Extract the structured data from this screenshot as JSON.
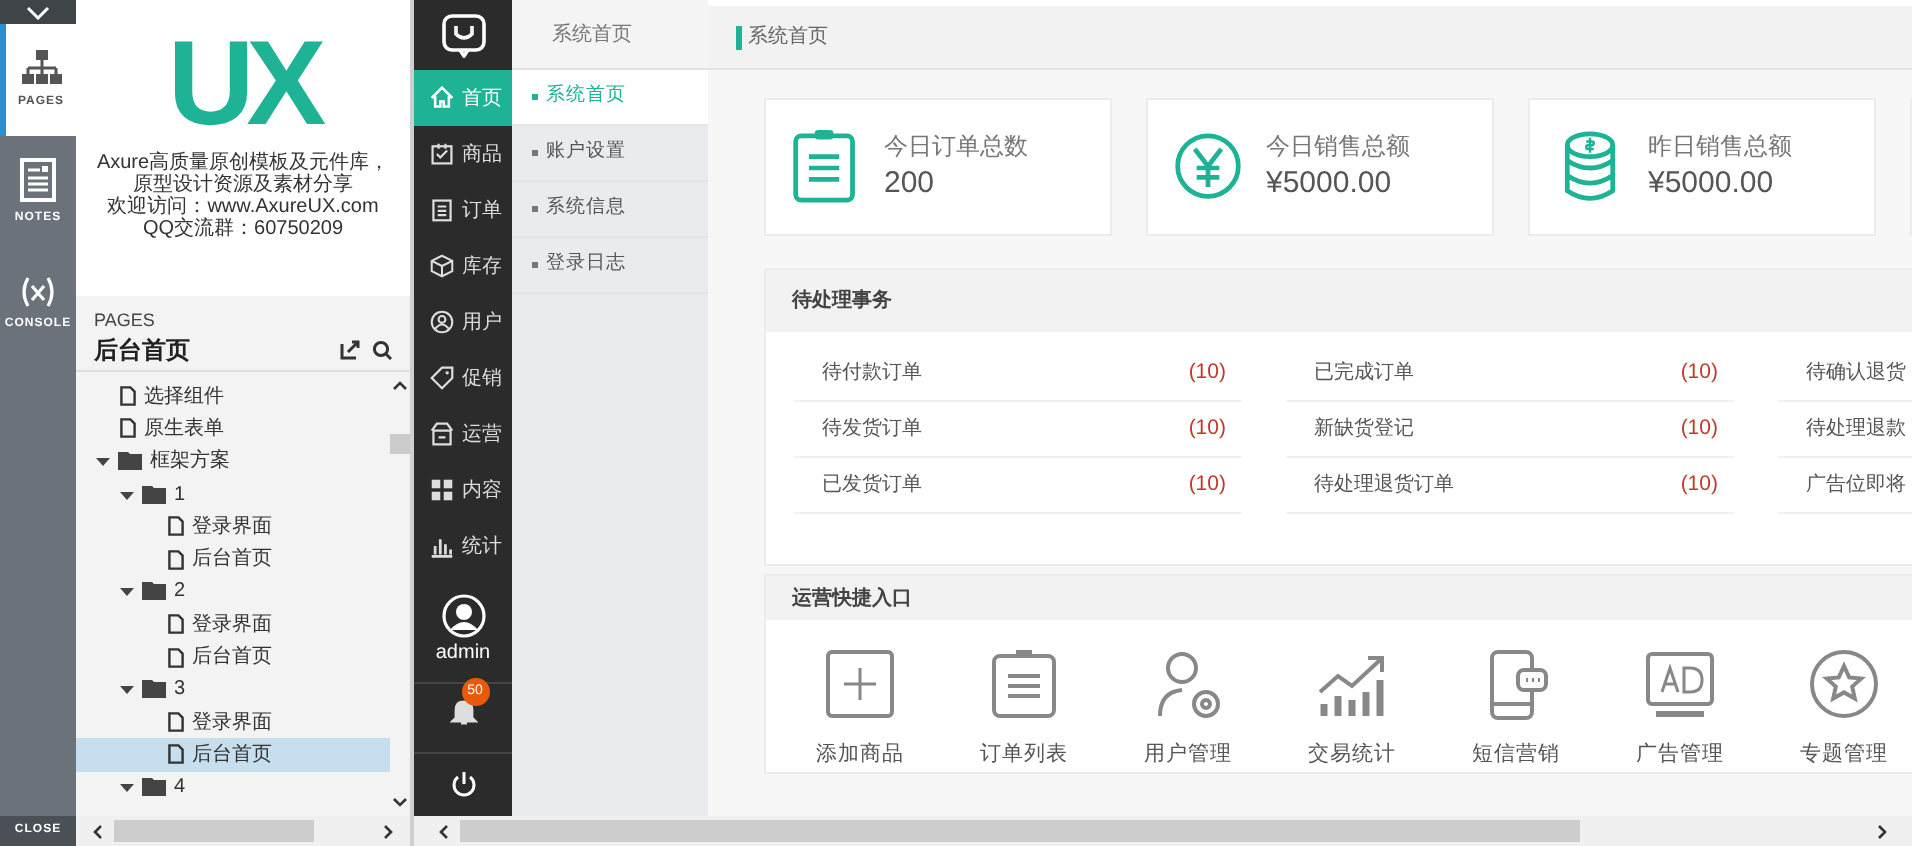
{
  "axure_toolbar": {
    "items": [
      {
        "label": "PAGES",
        "kind": "pages",
        "selected": true
      },
      {
        "label": "NOTES",
        "kind": "notes",
        "selected": false
      },
      {
        "label": "CONSOLE",
        "kind": "console",
        "selected": false
      }
    ],
    "close": "CLOSE"
  },
  "brand": {
    "logo": "UX",
    "lines": [
      "Axure高质量原创模板及元件库，原型设计资源及素材分享",
      "欢迎访问：www.AxureUX.com",
      "QQ交流群：60750209"
    ]
  },
  "pages_panel": {
    "heading": "PAGES",
    "current_page": "后台首页",
    "tree": [
      {
        "kind": "page",
        "label": "选择组件",
        "selected": false
      },
      {
        "kind": "page",
        "label": "原生表单",
        "selected": false
      },
      {
        "kind": "folder",
        "label": "框架方案",
        "expanded": true,
        "children": [
          {
            "kind": "folder",
            "label": "1",
            "expanded": true,
            "children": [
              {
                "kind": "page",
                "label": "登录界面",
                "selected": false
              },
              {
                "kind": "page",
                "label": "后台首页",
                "selected": false
              }
            ]
          },
          {
            "kind": "folder",
            "label": "2",
            "expanded": true,
            "children": [
              {
                "kind": "page",
                "label": "登录界面",
                "selected": false
              },
              {
                "kind": "page",
                "label": "后台首页",
                "selected": false
              }
            ]
          },
          {
            "kind": "folder",
            "label": "3",
            "expanded": true,
            "children": [
              {
                "kind": "page",
                "label": "登录界面",
                "selected": false
              },
              {
                "kind": "page",
                "label": "后台首页",
                "selected": true
              }
            ]
          },
          {
            "kind": "folder",
            "label": "4",
            "expanded": true
          }
        ]
      }
    ]
  },
  "app_sidebar": {
    "nav": [
      {
        "label": "首页",
        "kind": "home",
        "selected": true
      },
      {
        "label": "商品",
        "kind": "goods",
        "selected": false
      },
      {
        "label": "订单",
        "kind": "order",
        "selected": false
      },
      {
        "label": "库存",
        "kind": "stock",
        "selected": false
      },
      {
        "label": "用户",
        "kind": "user",
        "selected": false
      },
      {
        "label": "促销",
        "kind": "tag",
        "selected": false
      },
      {
        "label": "运营",
        "kind": "shop",
        "selected": false
      },
      {
        "label": "内容",
        "kind": "grid",
        "selected": false
      },
      {
        "label": "统计",
        "kind": "chart",
        "selected": false
      }
    ],
    "user": "admin",
    "notification_count": "50"
  },
  "submenu": {
    "title": "系统首页",
    "items": [
      {
        "label": "系统首页",
        "selected": true
      },
      {
        "label": "账户设置",
        "selected": false
      },
      {
        "label": "系统信息",
        "selected": false
      },
      {
        "label": "登录日志",
        "selected": false
      }
    ]
  },
  "breadcrumb": "系统首页",
  "stat_cards": [
    {
      "kind": "clipboard",
      "label": "今日订单总数",
      "value": "200"
    },
    {
      "kind": "yen",
      "label": "今日销售总额",
      "value": "¥5000.00"
    },
    {
      "kind": "coins",
      "label": "昨日销售总额",
      "value": "¥5000.00"
    }
  ],
  "pending": {
    "title": "待处理事务",
    "columns": [
      [
        {
          "label": "待付款订单",
          "count": "(10)"
        },
        {
          "label": "待发货订单",
          "count": "(10)"
        },
        {
          "label": "已发货订单",
          "count": "(10)"
        }
      ],
      [
        {
          "label": "已完成订单",
          "count": "(10)"
        },
        {
          "label": "新缺货登记",
          "count": "(10)"
        },
        {
          "label": "待处理退货订单",
          "count": "(10)"
        }
      ],
      [
        {
          "label": "待确认退货"
        },
        {
          "label": "待处理退款"
        },
        {
          "label": "广告位即将"
        }
      ]
    ]
  },
  "quick": {
    "title": "运营快捷入口",
    "items": [
      {
        "kind": "plus",
        "label": "添加商品"
      },
      {
        "kind": "list",
        "label": "订单列表"
      },
      {
        "kind": "usergear",
        "label": "用户管理"
      },
      {
        "kind": "trend",
        "label": "交易统计"
      },
      {
        "kind": "phone",
        "label": "短信营销"
      },
      {
        "kind": "ad",
        "label": "广告管理"
      },
      {
        "kind": "star",
        "label": "专题管理"
      }
    ]
  }
}
